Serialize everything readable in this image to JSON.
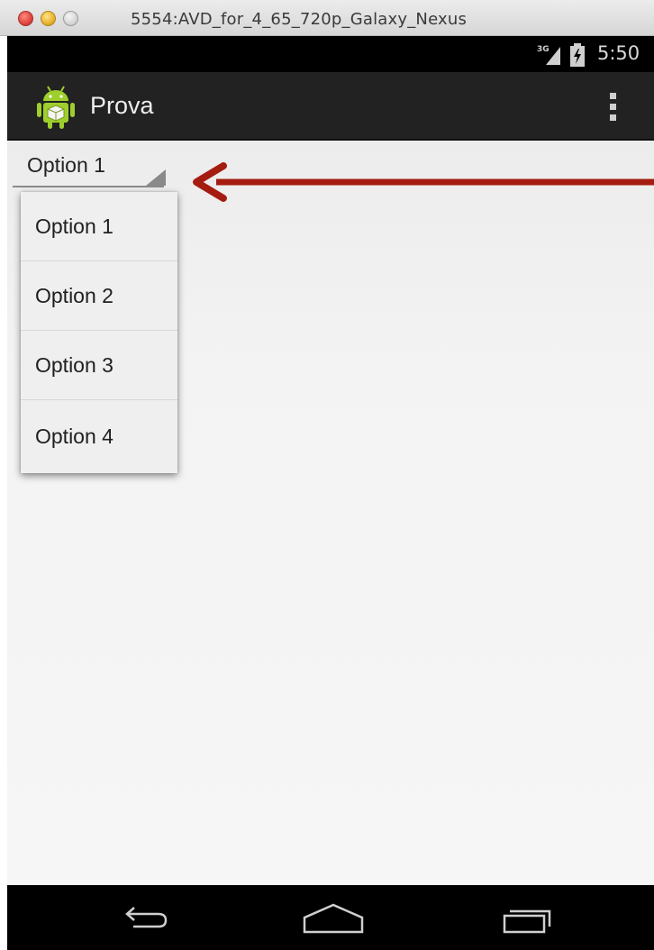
{
  "window": {
    "title": "5554:AVD_for_4_65_720p_Galaxy_Nexus"
  },
  "status_bar": {
    "network": "3G",
    "time": "5:50"
  },
  "action_bar": {
    "app_title": "Prova",
    "app_icon": "android-robot-icon",
    "overflow_icon": "overflow-menu-icon"
  },
  "spinner": {
    "selected": "Option 1",
    "options": [
      "Option 1",
      "Option 2",
      "Option 3",
      "Option 4"
    ]
  },
  "annotation": {
    "arrow_color": "#a51c10"
  },
  "nav_bar": {
    "icons": [
      "back-icon",
      "home-icon",
      "recents-icon"
    ]
  }
}
